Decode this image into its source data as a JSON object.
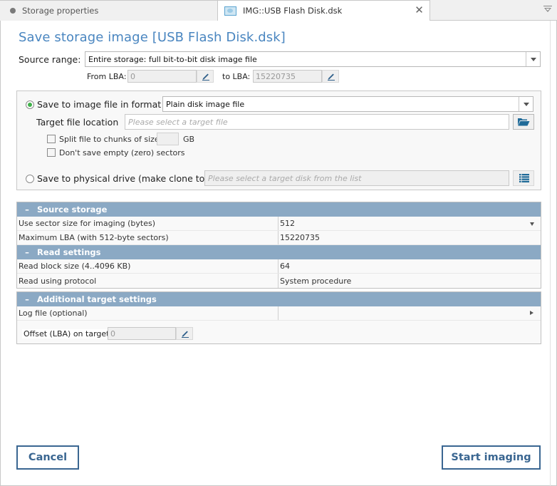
{
  "tabs": [
    {
      "label": "Storage properties",
      "active": false
    },
    {
      "label": "IMG::USB Flash Disk.dsk",
      "active": true
    }
  ],
  "title": "Save storage image [USB Flash Disk.dsk]",
  "source": {
    "label": "Source range:",
    "selected": "Entire storage: full bit-to-bit disk image file",
    "from_lba_label": "From LBA:",
    "from_lba_value": "0",
    "to_lba_label": "to LBA:",
    "to_lba_value": "15220735"
  },
  "target": {
    "image_option_label": "Save to image file in format",
    "image_option_selected": true,
    "format_selected": "Plain disk image file",
    "file_location_label": "Target file location",
    "file_location_placeholder": "Please select a target file",
    "split_label": "Split file to chunks of size:",
    "split_checked": false,
    "split_size_value": "",
    "split_unit": "GB",
    "skip_empty_label": "Don't save empty (zero) sectors",
    "skip_empty_checked": false,
    "drive_option_label": "Save to physical drive (make clone to)",
    "drive_option_selected": false,
    "drive_placeholder": "Please select a target disk from the list"
  },
  "grid": {
    "source_storage": {
      "header": "Source storage",
      "rows": [
        {
          "key": "Use sector size for imaging (bytes)",
          "value": "512"
        },
        {
          "key": "Maximum LBA (with 512-byte sectors)",
          "value": "15220735"
        }
      ]
    },
    "read_settings": {
      "header": "Read settings",
      "rows": [
        {
          "key": "Read block size (4..4096 KB)",
          "value": "64"
        },
        {
          "key": "Read using protocol",
          "value": "System procedure"
        }
      ]
    },
    "additional": {
      "header": "Additional target settings",
      "rows": [
        {
          "key": "Log file (optional)",
          "value": ""
        }
      ],
      "offset_label": "Offset (LBA) on target:",
      "offset_value": "0"
    }
  },
  "buttons": {
    "cancel": "Cancel",
    "start": "Start imaging"
  },
  "colors": {
    "accent": "#4a86c0",
    "grid_header": "#8ba9c4",
    "button_border": "#3a6691",
    "radio_selected": "#3fb04a"
  }
}
